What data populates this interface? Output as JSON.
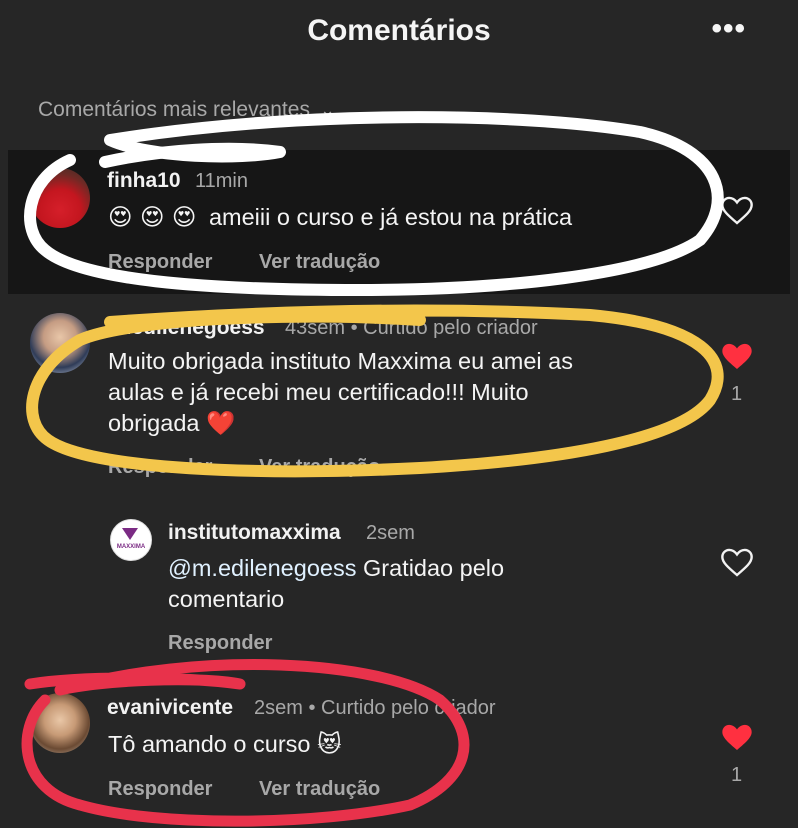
{
  "header": {
    "title": "Comentários",
    "more_icon": "more-horizontal-icon"
  },
  "sort": {
    "label": "Comentários mais relevantes",
    "icon": "chevron-down-icon"
  },
  "comments": [
    {
      "username": "finha10",
      "meta": "11min",
      "emojis": "😍 😍 😍",
      "text": "ameiii o curso e já estou na prática",
      "reply_label": "Responder",
      "translate_label": "Ver tradução"
    },
    {
      "username": "m.edilenegoess",
      "meta": "43sem • Curtido pelo criador",
      "text_line1": "Muito obrigada instituto Maxxima eu amei as",
      "text_line2": "aulas e já recebi meu certificado!!! Muito",
      "text_line3": "obrigada ❤️",
      "like_count": "1",
      "reply_label": "Responder",
      "translate_label": "Ver tradução"
    },
    {
      "username": "institutomaxxima",
      "meta": "2sem",
      "mention": "@m.edilenegoess",
      "text_rest": " Gratidao pelo",
      "text_line2": "comentario",
      "reply_label": "Responder",
      "avatar_text": "MAXXIMA"
    },
    {
      "username": "evanivicente",
      "meta": "2sem • Curtido pelo criador",
      "text": "Tô amando o curso 😻",
      "like_count": "1",
      "reply_label": "Responder",
      "translate_label": "Ver tradução"
    }
  ],
  "colors": {
    "background": "#262626",
    "highlight": "#161616",
    "like_red": "#ff3040",
    "annotation_white": "#ffffff",
    "annotation_yellow": "#f3c64b",
    "annotation_red": "#e8324b",
    "mention_blue": "#e0f1ff"
  }
}
